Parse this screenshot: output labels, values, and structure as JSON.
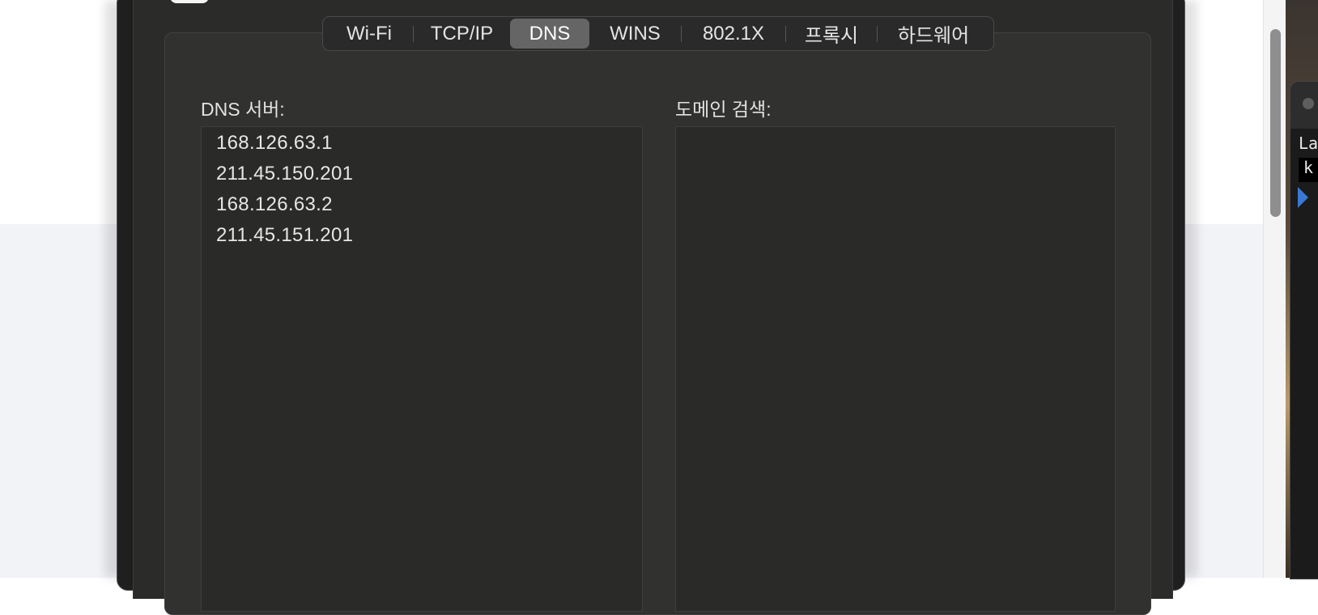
{
  "tabs": [
    {
      "label": "Wi-Fi",
      "active": false
    },
    {
      "label": "TCP/IP",
      "active": false
    },
    {
      "label": "DNS",
      "active": true
    },
    {
      "label": "WINS",
      "active": false
    },
    {
      "label": "802.1X",
      "active": false
    },
    {
      "label": "프록시",
      "active": false
    },
    {
      "label": "하드웨어",
      "active": false
    }
  ],
  "dns": {
    "label": "DNS 서버:",
    "servers": [
      "168.126.63.1",
      "211.45.150.201",
      "168.126.63.2",
      "211.45.151.201"
    ]
  },
  "search_domains": {
    "label": "도메인 검색:",
    "domains": []
  },
  "terminal": {
    "line1": "La",
    "line2": "k"
  },
  "colors": {
    "window_bg": "#2b2b2a",
    "group_bg": "#313130",
    "active_tab": "#656565",
    "text": "#e6e6e6",
    "caret": "#3a78d6"
  }
}
